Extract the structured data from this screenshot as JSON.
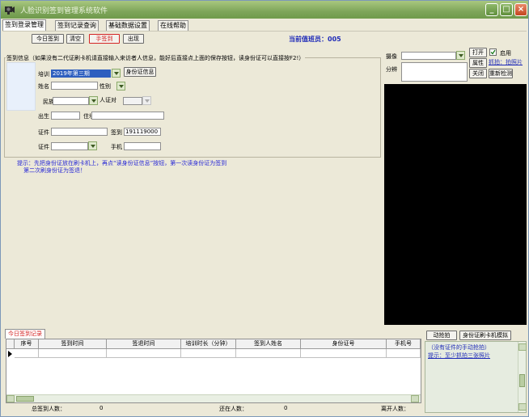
{
  "window": {
    "title": "人脸识别签到管理系统软件",
    "controls": {
      "minimize": "_",
      "maximize": "□",
      "close": "×"
    }
  },
  "menu_tabs": [
    "签到登录管理",
    "签到记录查询",
    "基础数据设置",
    "在线帮助"
  ],
  "toolbar": {
    "today_signin": "今日签到",
    "clear": "清空",
    "exit_signin": "手签到",
    "exit": "出现"
  },
  "duty_officer": "当前值班员：005",
  "signin_group": {
    "legend": "签到信息（如果没有二代证刷卡机请直接输入来访者人信息，能好后直接点上面的保存按钮，读身份证可以直接按F2!）",
    "training_label": "培训",
    "training_value": "2019年第三期",
    "id_info_button": "身份证信息",
    "name_label": "姓名",
    "gender_label": "性别",
    "ethnicity_label": "民族",
    "id_compare_label": "人证对",
    "birth_label": "出生",
    "address_label": "住址",
    "id_number_label": "证件",
    "signin_label": "签到",
    "signin_value": "191119000",
    "doc_type_label": "证件",
    "phone_label": "手机"
  },
  "tip": {
    "line1": "提示：先把身份证放在刷卡机上，再点“读身份证信息”按钮，第一次读身份证为签到",
    "line2": "第二次刷身份证为签退！"
  },
  "camera_panel": {
    "camera_label": "摄像",
    "resolution_label": "分辨",
    "open_button": "打开",
    "enable_label": "启用",
    "property_button": "属性",
    "photo_link": "抓拍：拍照片",
    "close_button": "关闭",
    "refresh_button": "重新检测"
  },
  "records": {
    "tab": "今日签到记录",
    "columns": [
      "序号",
      "签到时间",
      "签退时间",
      "培训时长（分钟）",
      "签到人姓名",
      "身份证号",
      "手机号"
    ]
  },
  "status": {
    "total_label": "总签到人数：",
    "total_value": "0",
    "present_label": "还在人数：",
    "present_value": "0",
    "left_label": "离开人数："
  },
  "snap_panel": {
    "manual_snap_button": "动抢拍",
    "simulate_button": "身份证刷卡机模拟",
    "hint1": "（没有证件的手动抢拍）",
    "hint2": "提示：至少抓拍三张照片"
  },
  "colors": {
    "accent_blue": "#1f2bb8",
    "alert_red": "#d42424",
    "title_green": "#7ea55a"
  }
}
